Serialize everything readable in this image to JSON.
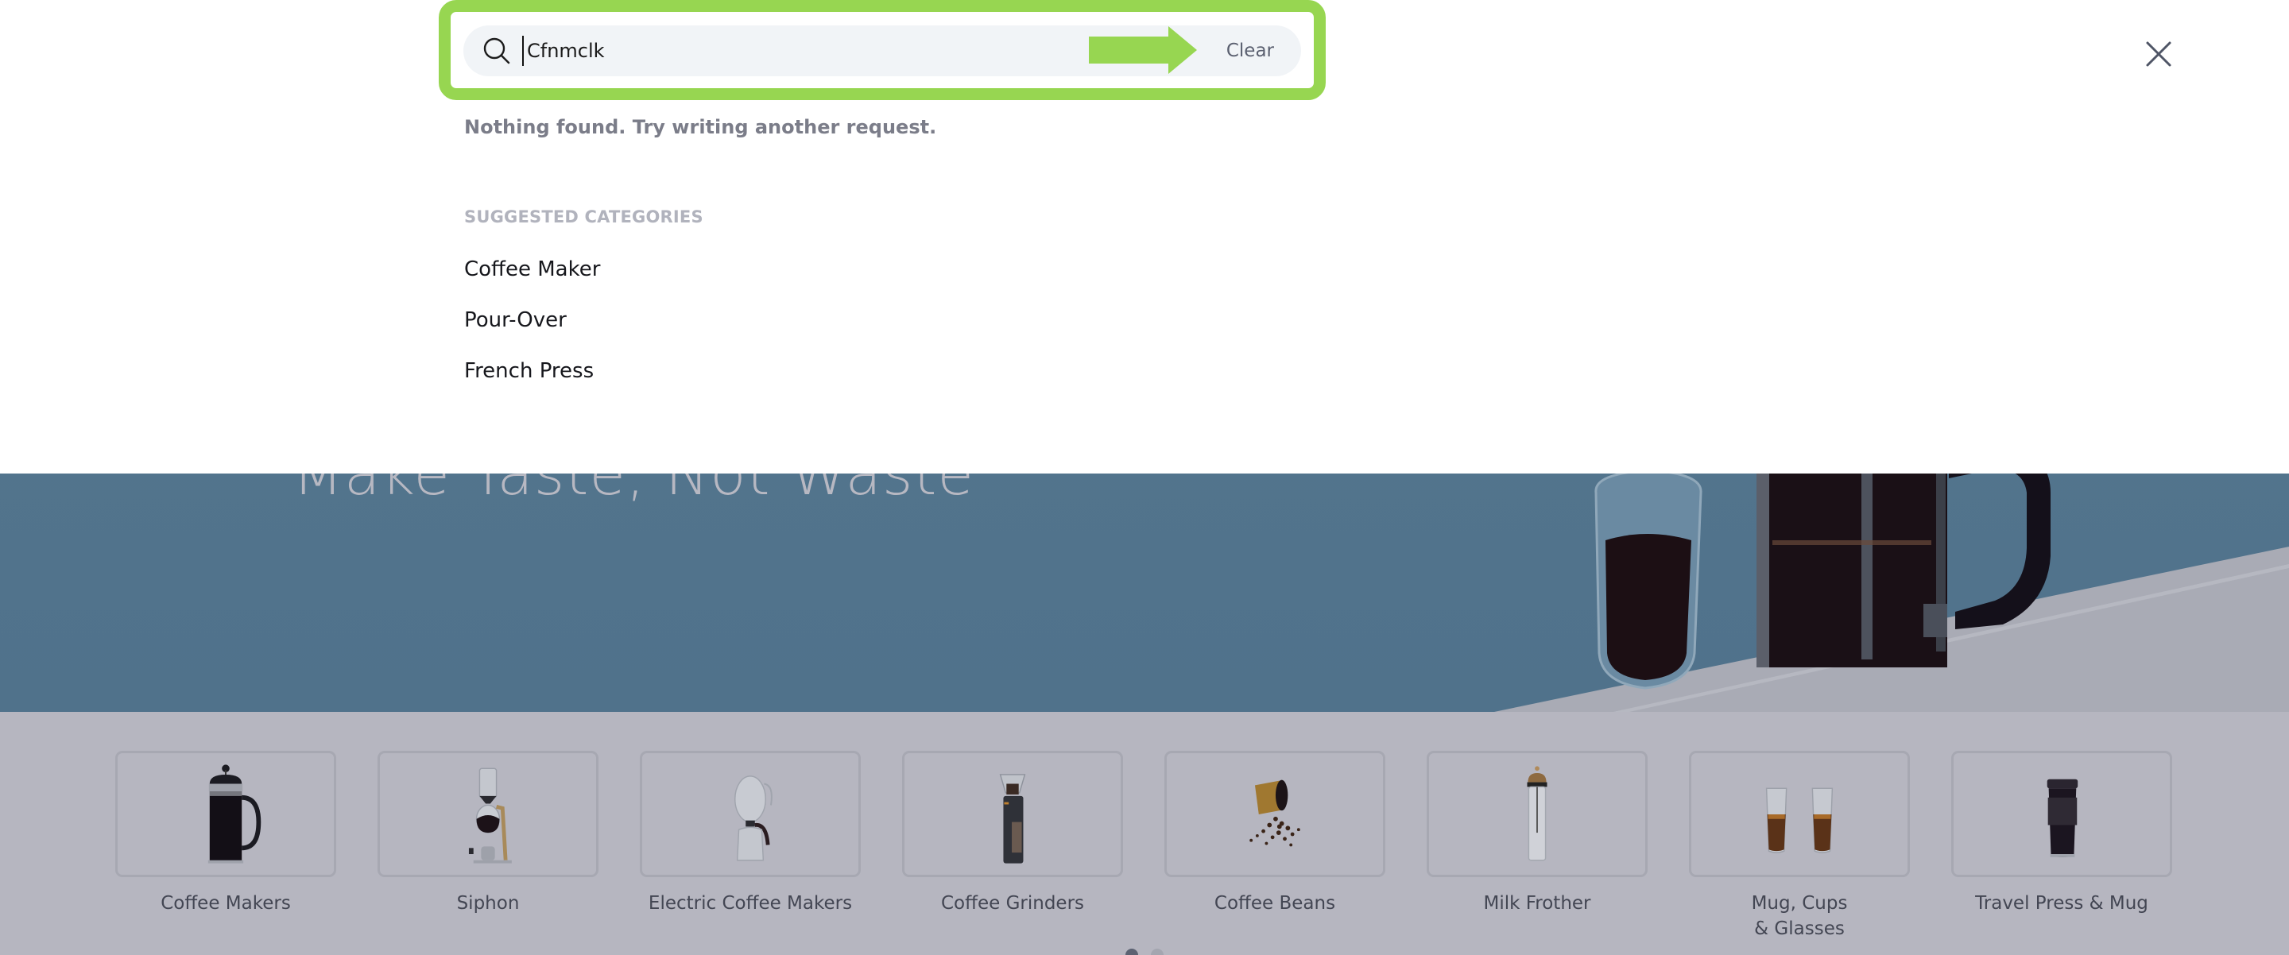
{
  "search": {
    "query": "Cfnmclk",
    "clear_label": "Clear",
    "icon": "search-icon",
    "close_icon": "close-icon",
    "annotation_icon": "arrow-right-icon",
    "highlight_color": "#97d651"
  },
  "results": {
    "empty_message": "Nothing found. Try writing another request.",
    "suggested_title": "SUGGESTED CATEGORIES",
    "suggested": [
      "Coffee Maker",
      "Pour-Over",
      "French Press"
    ]
  },
  "hero": {
    "heading": "Make Taste, Not Waste",
    "heading_mark": "®"
  },
  "categories": {
    "items": [
      {
        "label": "Coffee Makers",
        "icon": "french-press-icon"
      },
      {
        "label": "Siphon",
        "icon": "siphon-icon"
      },
      {
        "label": "Electric Coffee Makers",
        "icon": "electric-coffee-maker-icon"
      },
      {
        "label": "Coffee Grinders",
        "icon": "coffee-grinder-icon"
      },
      {
        "label": "Coffee Beans",
        "icon": "coffee-beans-icon"
      },
      {
        "label": "Milk Frother",
        "icon": "milk-frother-icon"
      },
      {
        "label": "Mug, Cups\n& Glasses",
        "icon": "glasses-icon"
      },
      {
        "label": "Travel Press & Mug",
        "icon": "travel-mug-icon"
      }
    ],
    "carousel": {
      "pages": 2,
      "active_page": 1
    }
  }
}
